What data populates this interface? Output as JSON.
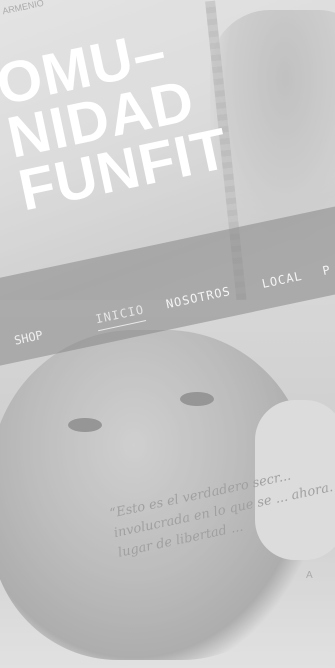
{
  "hero": {
    "topline": "ARMENIO",
    "title_lines": [
      "OMU–",
      "NIDAD",
      "FUNFIT"
    ]
  },
  "nav": {
    "logo": "SHOP",
    "items": [
      "INICIO",
      "NOSOTROS",
      "LOCAL",
      "P"
    ]
  },
  "quote": {
    "text": "“Esto es el verdadero secr... involucrada en lo que se ... ahora. Un lugar de libertad ...",
    "author": "A"
  },
  "colors": {
    "title": "#ffffff",
    "nav_band": "#5a5a5a"
  }
}
